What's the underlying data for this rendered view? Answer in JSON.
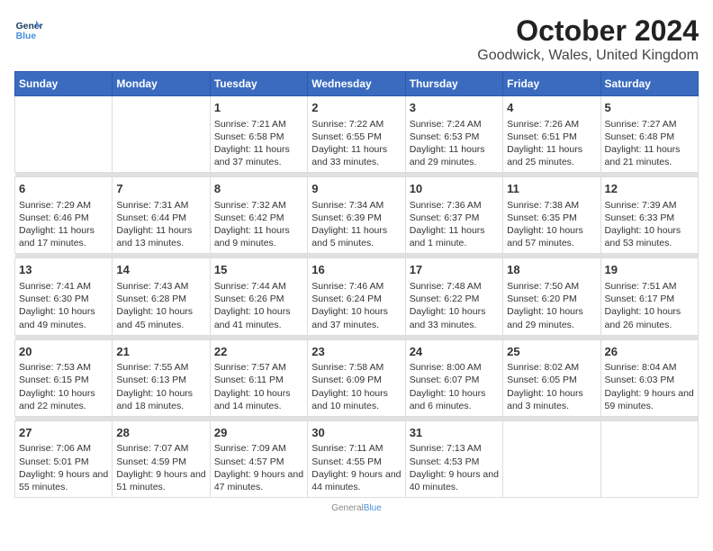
{
  "logo": {
    "general": "General",
    "blue": "Blue"
  },
  "title": "October 2024",
  "subtitle": "Goodwick, Wales, United Kingdom",
  "days_of_week": [
    "Sunday",
    "Monday",
    "Tuesday",
    "Wednesday",
    "Thursday",
    "Friday",
    "Saturday"
  ],
  "weeks": [
    [
      {
        "num": "",
        "sunrise": "",
        "sunset": "",
        "daylight": ""
      },
      {
        "num": "",
        "sunrise": "",
        "sunset": "",
        "daylight": ""
      },
      {
        "num": "1",
        "sunrise": "Sunrise: 7:21 AM",
        "sunset": "Sunset: 6:58 PM",
        "daylight": "Daylight: 11 hours and 37 minutes."
      },
      {
        "num": "2",
        "sunrise": "Sunrise: 7:22 AM",
        "sunset": "Sunset: 6:55 PM",
        "daylight": "Daylight: 11 hours and 33 minutes."
      },
      {
        "num": "3",
        "sunrise": "Sunrise: 7:24 AM",
        "sunset": "Sunset: 6:53 PM",
        "daylight": "Daylight: 11 hours and 29 minutes."
      },
      {
        "num": "4",
        "sunrise": "Sunrise: 7:26 AM",
        "sunset": "Sunset: 6:51 PM",
        "daylight": "Daylight: 11 hours and 25 minutes."
      },
      {
        "num": "5",
        "sunrise": "Sunrise: 7:27 AM",
        "sunset": "Sunset: 6:48 PM",
        "daylight": "Daylight: 11 hours and 21 minutes."
      }
    ],
    [
      {
        "num": "6",
        "sunrise": "Sunrise: 7:29 AM",
        "sunset": "Sunset: 6:46 PM",
        "daylight": "Daylight: 11 hours and 17 minutes."
      },
      {
        "num": "7",
        "sunrise": "Sunrise: 7:31 AM",
        "sunset": "Sunset: 6:44 PM",
        "daylight": "Daylight: 11 hours and 13 minutes."
      },
      {
        "num": "8",
        "sunrise": "Sunrise: 7:32 AM",
        "sunset": "Sunset: 6:42 PM",
        "daylight": "Daylight: 11 hours and 9 minutes."
      },
      {
        "num": "9",
        "sunrise": "Sunrise: 7:34 AM",
        "sunset": "Sunset: 6:39 PM",
        "daylight": "Daylight: 11 hours and 5 minutes."
      },
      {
        "num": "10",
        "sunrise": "Sunrise: 7:36 AM",
        "sunset": "Sunset: 6:37 PM",
        "daylight": "Daylight: 11 hours and 1 minute."
      },
      {
        "num": "11",
        "sunrise": "Sunrise: 7:38 AM",
        "sunset": "Sunset: 6:35 PM",
        "daylight": "Daylight: 10 hours and 57 minutes."
      },
      {
        "num": "12",
        "sunrise": "Sunrise: 7:39 AM",
        "sunset": "Sunset: 6:33 PM",
        "daylight": "Daylight: 10 hours and 53 minutes."
      }
    ],
    [
      {
        "num": "13",
        "sunrise": "Sunrise: 7:41 AM",
        "sunset": "Sunset: 6:30 PM",
        "daylight": "Daylight: 10 hours and 49 minutes."
      },
      {
        "num": "14",
        "sunrise": "Sunrise: 7:43 AM",
        "sunset": "Sunset: 6:28 PM",
        "daylight": "Daylight: 10 hours and 45 minutes."
      },
      {
        "num": "15",
        "sunrise": "Sunrise: 7:44 AM",
        "sunset": "Sunset: 6:26 PM",
        "daylight": "Daylight: 10 hours and 41 minutes."
      },
      {
        "num": "16",
        "sunrise": "Sunrise: 7:46 AM",
        "sunset": "Sunset: 6:24 PM",
        "daylight": "Daylight: 10 hours and 37 minutes."
      },
      {
        "num": "17",
        "sunrise": "Sunrise: 7:48 AM",
        "sunset": "Sunset: 6:22 PM",
        "daylight": "Daylight: 10 hours and 33 minutes."
      },
      {
        "num": "18",
        "sunrise": "Sunrise: 7:50 AM",
        "sunset": "Sunset: 6:20 PM",
        "daylight": "Daylight: 10 hours and 29 minutes."
      },
      {
        "num": "19",
        "sunrise": "Sunrise: 7:51 AM",
        "sunset": "Sunset: 6:17 PM",
        "daylight": "Daylight: 10 hours and 26 minutes."
      }
    ],
    [
      {
        "num": "20",
        "sunrise": "Sunrise: 7:53 AM",
        "sunset": "Sunset: 6:15 PM",
        "daylight": "Daylight: 10 hours and 22 minutes."
      },
      {
        "num": "21",
        "sunrise": "Sunrise: 7:55 AM",
        "sunset": "Sunset: 6:13 PM",
        "daylight": "Daylight: 10 hours and 18 minutes."
      },
      {
        "num": "22",
        "sunrise": "Sunrise: 7:57 AM",
        "sunset": "Sunset: 6:11 PM",
        "daylight": "Daylight: 10 hours and 14 minutes."
      },
      {
        "num": "23",
        "sunrise": "Sunrise: 7:58 AM",
        "sunset": "Sunset: 6:09 PM",
        "daylight": "Daylight: 10 hours and 10 minutes."
      },
      {
        "num": "24",
        "sunrise": "Sunrise: 8:00 AM",
        "sunset": "Sunset: 6:07 PM",
        "daylight": "Daylight: 10 hours and 6 minutes."
      },
      {
        "num": "25",
        "sunrise": "Sunrise: 8:02 AM",
        "sunset": "Sunset: 6:05 PM",
        "daylight": "Daylight: 10 hours and 3 minutes."
      },
      {
        "num": "26",
        "sunrise": "Sunrise: 8:04 AM",
        "sunset": "Sunset: 6:03 PM",
        "daylight": "Daylight: 9 hours and 59 minutes."
      }
    ],
    [
      {
        "num": "27",
        "sunrise": "Sunrise: 7:06 AM",
        "sunset": "Sunset: 5:01 PM",
        "daylight": "Daylight: 9 hours and 55 minutes."
      },
      {
        "num": "28",
        "sunrise": "Sunrise: 7:07 AM",
        "sunset": "Sunset: 4:59 PM",
        "daylight": "Daylight: 9 hours and 51 minutes."
      },
      {
        "num": "29",
        "sunrise": "Sunrise: 7:09 AM",
        "sunset": "Sunset: 4:57 PM",
        "daylight": "Daylight: 9 hours and 47 minutes."
      },
      {
        "num": "30",
        "sunrise": "Sunrise: 7:11 AM",
        "sunset": "Sunset: 4:55 PM",
        "daylight": "Daylight: 9 hours and 44 minutes."
      },
      {
        "num": "31",
        "sunrise": "Sunrise: 7:13 AM",
        "sunset": "Sunset: 4:53 PM",
        "daylight": "Daylight: 9 hours and 40 minutes."
      },
      {
        "num": "",
        "sunrise": "",
        "sunset": "",
        "daylight": ""
      },
      {
        "num": "",
        "sunrise": "",
        "sunset": "",
        "daylight": ""
      }
    ]
  ]
}
